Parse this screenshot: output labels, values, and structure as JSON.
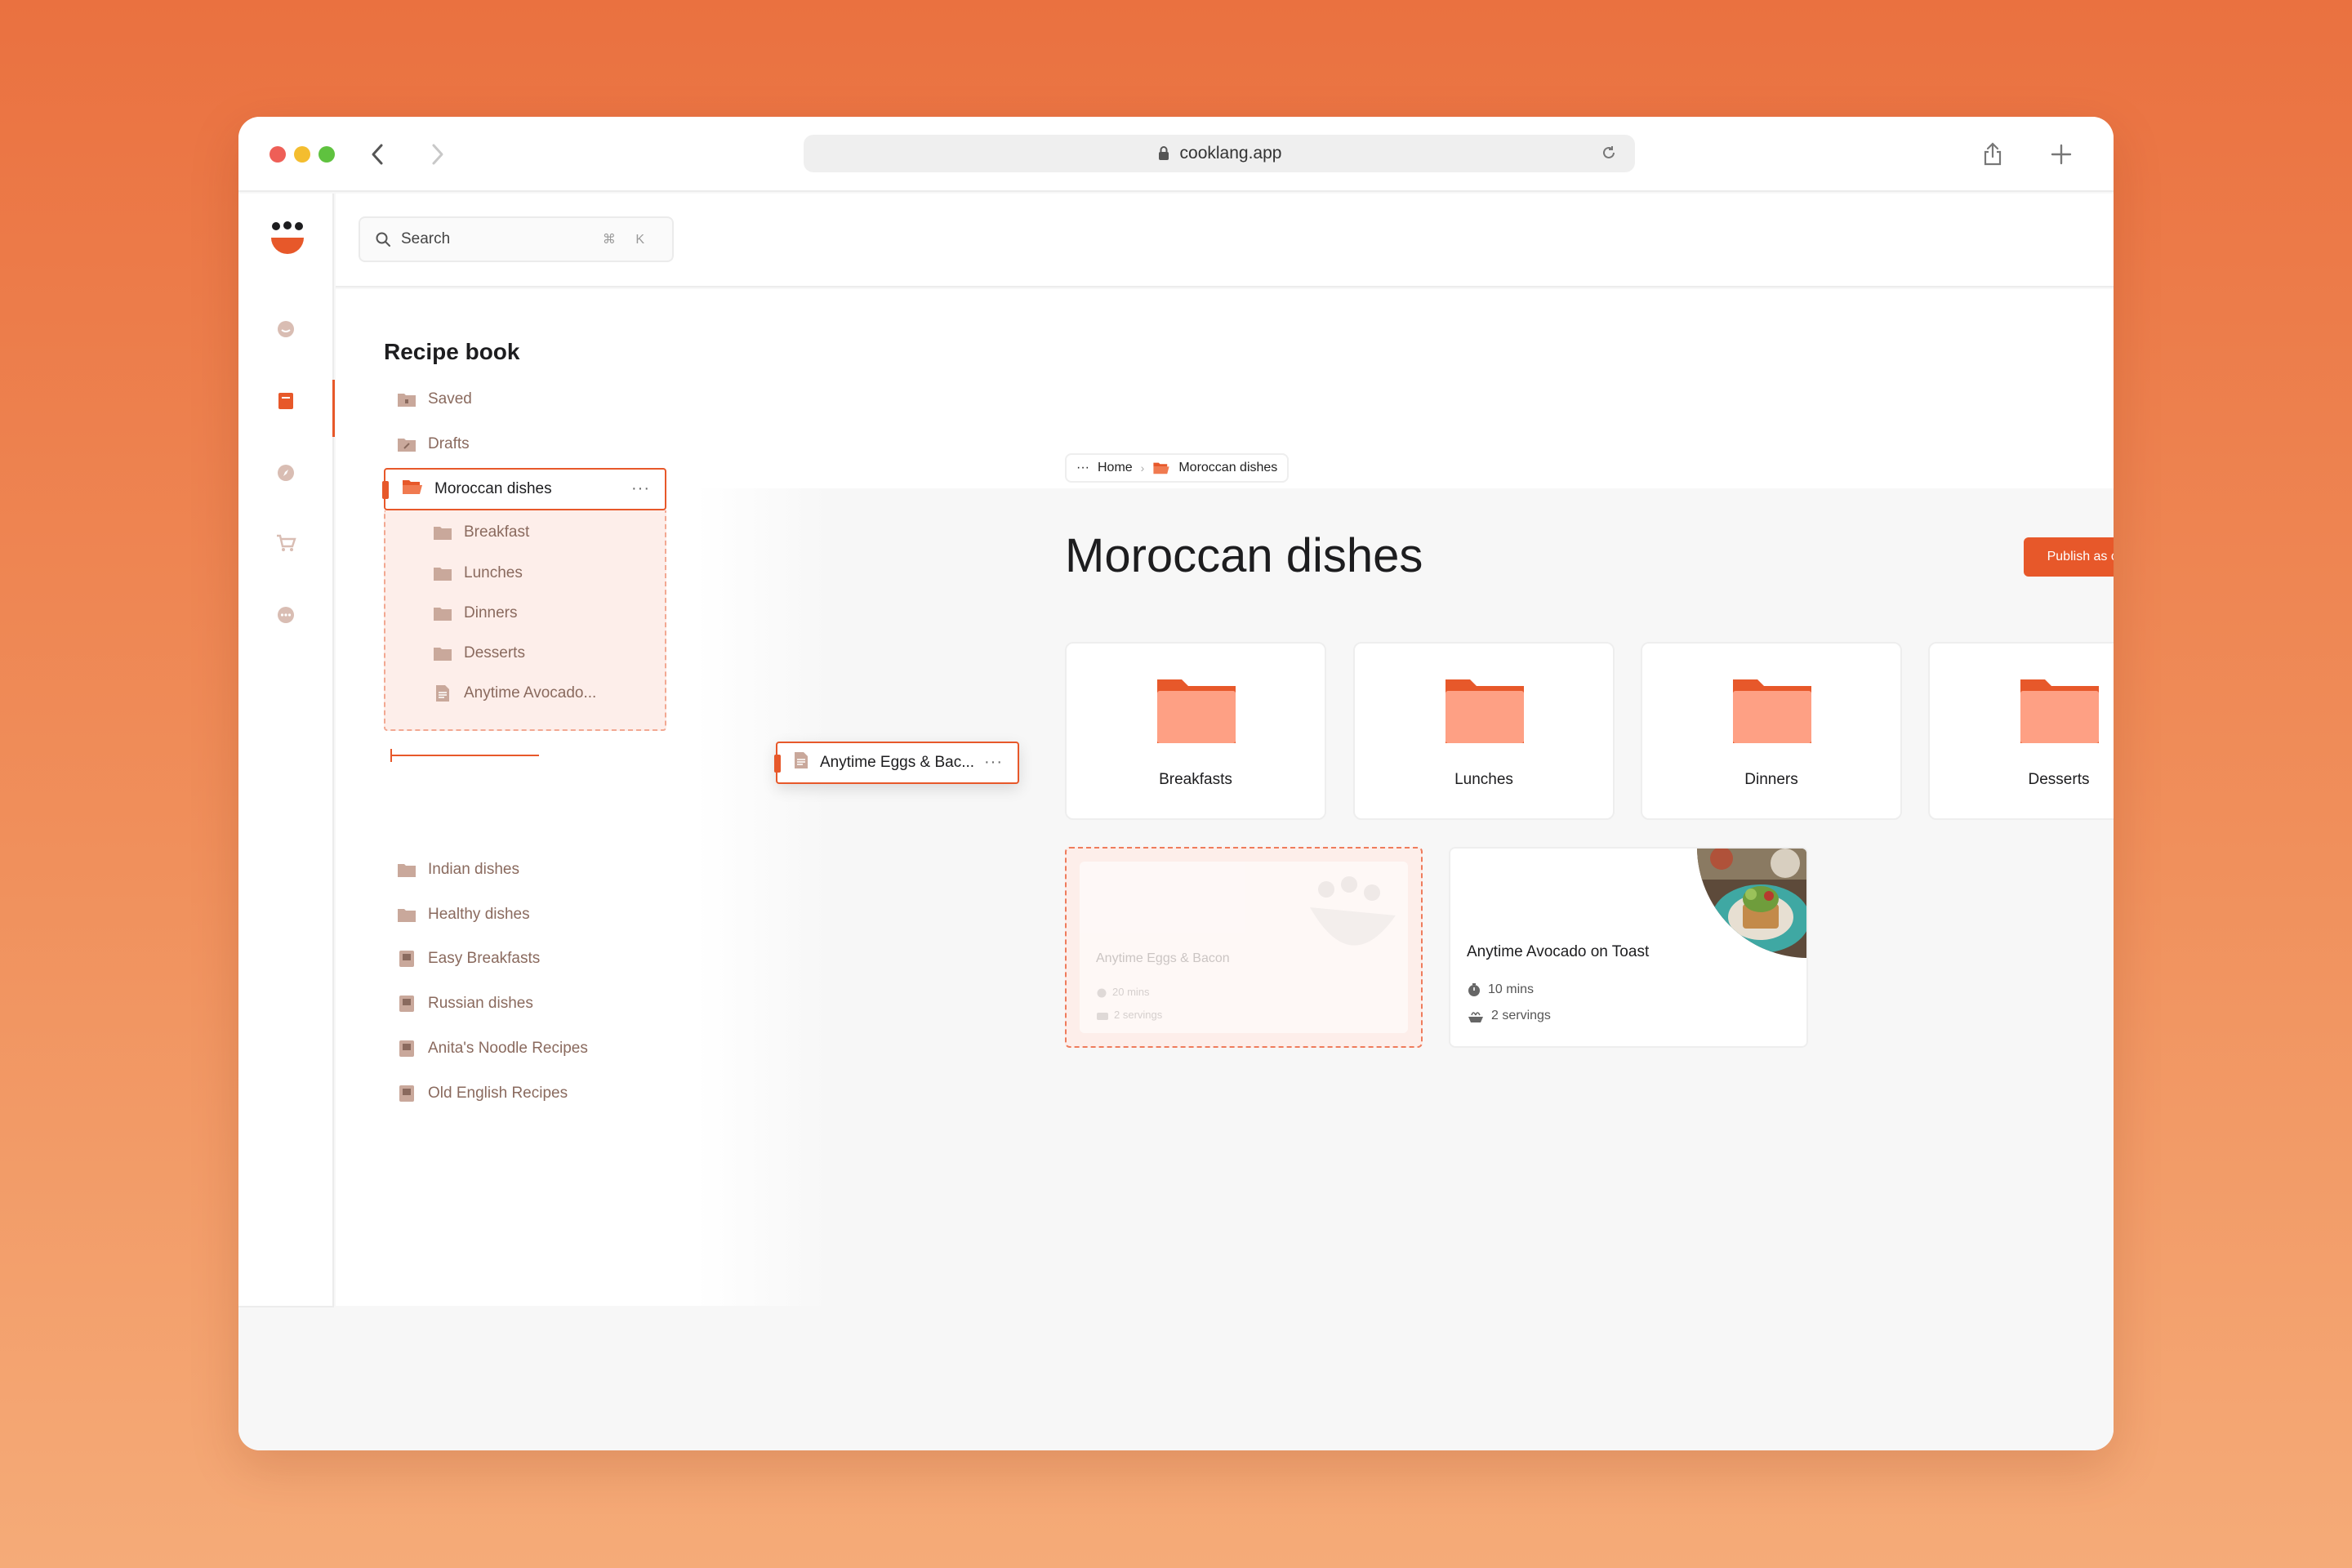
{
  "browser": {
    "url": "cooklang.app"
  },
  "search": {
    "placeholder": "Search",
    "shortcut": "⌘ K"
  },
  "topbar": {
    "add_label": "+"
  },
  "sidebar": {
    "title": "Recipe book",
    "items": [
      {
        "label": "Saved"
      },
      {
        "label": "Drafts"
      },
      {
        "label": "Moroccan dishes"
      },
      {
        "label": "Indian dishes"
      },
      {
        "label": "Healthy dishes"
      },
      {
        "label": "Easy Breakfasts"
      },
      {
        "label": "Russian dishes"
      },
      {
        "label": "Anita's Noodle Recipes"
      },
      {
        "label": "Old English Recipes"
      }
    ],
    "subitems": [
      {
        "label": "Breakfast"
      },
      {
        "label": "Lunches"
      },
      {
        "label": "Dinners"
      },
      {
        "label": "Desserts"
      },
      {
        "label": "Anytime Avocado..."
      }
    ],
    "dragging_item": "Anytime Eggs & Bac..."
  },
  "breadcrumb": {
    "more": "···",
    "home": "Home",
    "current": "Moroccan dishes"
  },
  "page": {
    "title": "Moroccan dishes",
    "publish_label": "Publish as cookbook"
  },
  "folders": [
    {
      "name": "Breakfasts"
    },
    {
      "name": "Lunches"
    },
    {
      "name": "Dinners"
    },
    {
      "name": "Desserts"
    }
  ],
  "recipes": [
    {
      "title": "Anytime Eggs & Bacon",
      "time": "20 mins",
      "servings": "2 servings"
    },
    {
      "title": "Anytime Avocado on Toast",
      "time": "10 mins",
      "servings": "2 servings"
    }
  ],
  "colors": {
    "accent": "#e7582a",
    "folder": "#fea084",
    "folder_tab": "#e7582a",
    "sidebar_text": "#8a6a5e"
  }
}
